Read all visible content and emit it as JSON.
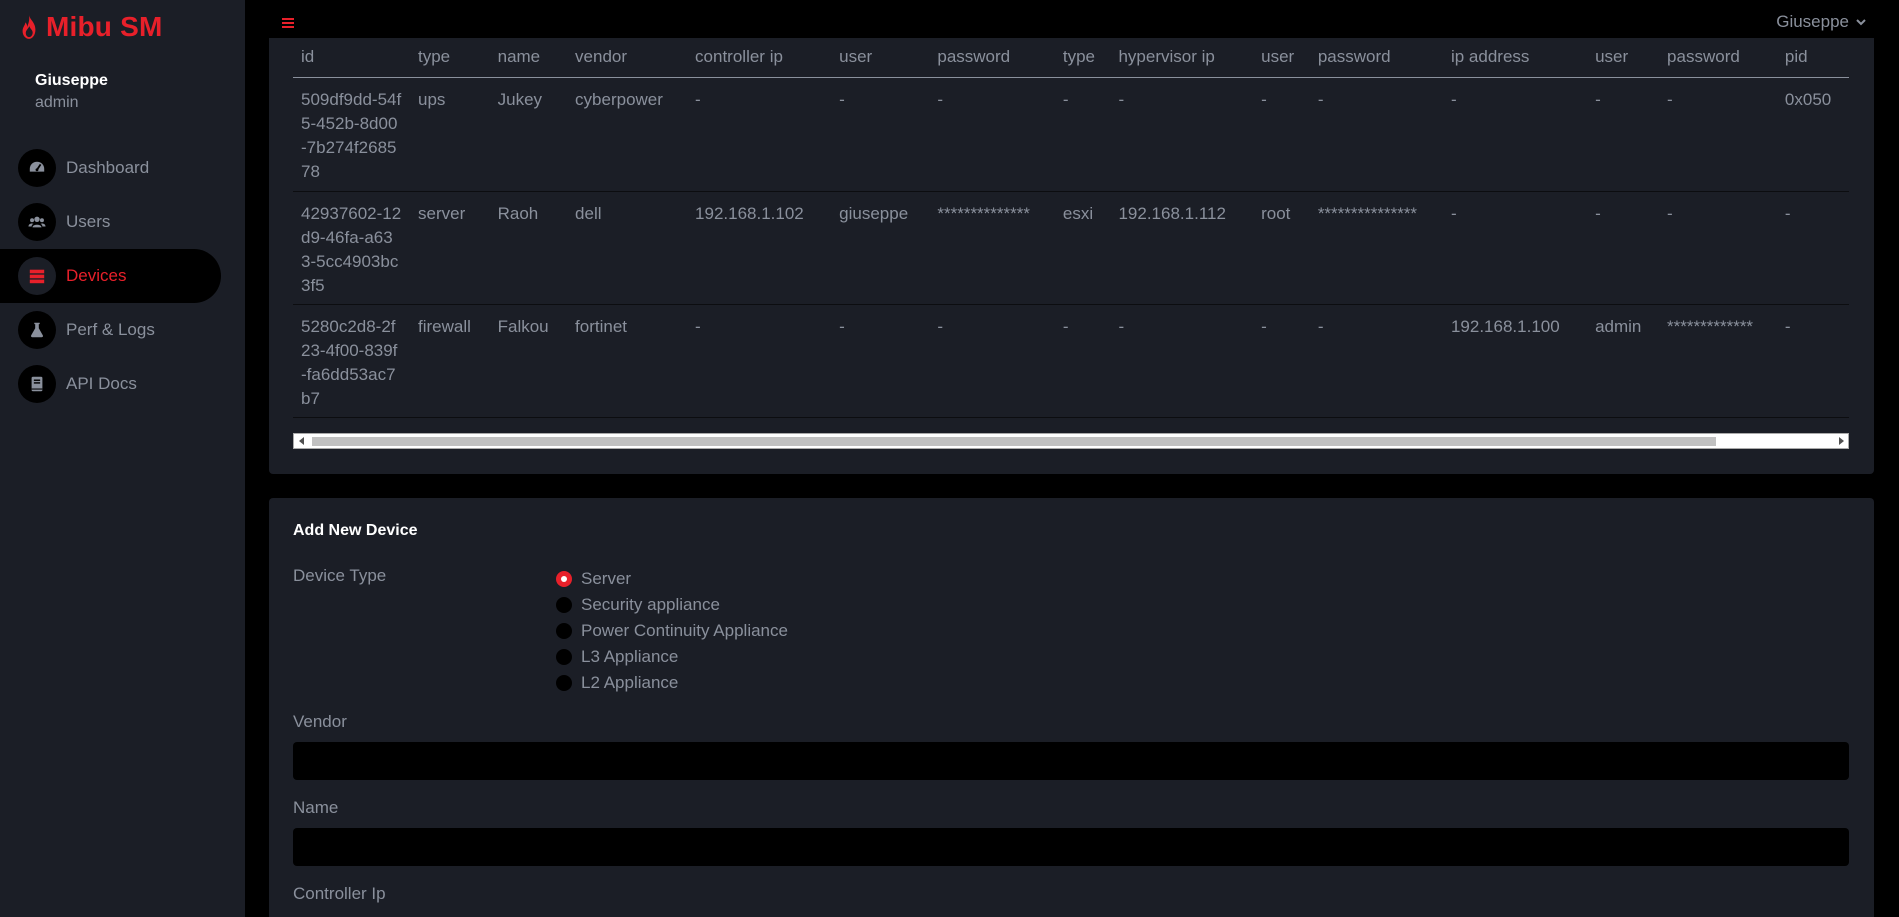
{
  "app": {
    "brand": "Mibu SM",
    "brand_color": "#e8202a"
  },
  "profile": {
    "name": "Giuseppe",
    "role": "admin"
  },
  "topbar": {
    "user_menu_label": "Giuseppe"
  },
  "sidebar": {
    "items": [
      {
        "label": "Dashboard",
        "icon": "dashboard-icon",
        "active": false
      },
      {
        "label": "Users",
        "icon": "users-icon",
        "active": false
      },
      {
        "label": "Devices",
        "icon": "devices-icon",
        "active": true
      },
      {
        "label": "Perf & Logs",
        "icon": "flask-icon",
        "active": false
      },
      {
        "label": "API Docs",
        "icon": "book-icon",
        "active": false
      }
    ]
  },
  "devices_table": {
    "columns": [
      "id",
      "type",
      "name",
      "vendor",
      "controller ip",
      "user",
      "password",
      "type",
      "hypervisor ip",
      "user",
      "password",
      "ip address",
      "user",
      "password",
      "pid"
    ],
    "rows": [
      [
        "509df9dd-54f5-452b-8d00-7b274f268578",
        "ups",
        "Jukey",
        "cyberpower",
        "-",
        "-",
        "-",
        "-",
        "-",
        "-",
        "-",
        "-",
        "-",
        "-",
        "0x050"
      ],
      [
        "42937602-12d9-46fa-a633-5cc4903bc3f5",
        "server",
        "Raoh",
        "dell",
        "192.168.1.102",
        "giuseppe",
        "**************",
        "esxi",
        "192.168.1.112",
        "root",
        "***************",
        "-",
        "-",
        "-",
        "-"
      ],
      [
        "5280c2d8-2f23-4f00-839f-fa6dd53ac7b7",
        "firewall",
        "Falkou",
        "fortinet",
        "-",
        "-",
        "-",
        "-",
        "-",
        "-",
        "-",
        "192.168.1.100",
        "admin",
        "*************",
        "-"
      ]
    ]
  },
  "add_device": {
    "title": "Add New Device",
    "device_type_label": "Device Type",
    "device_types": [
      {
        "label": "Server",
        "checked": true
      },
      {
        "label": "Security appliance",
        "checked": false
      },
      {
        "label": "Power Continuity Appliance",
        "checked": false
      },
      {
        "label": "L3 Appliance",
        "checked": false
      },
      {
        "label": "L2 Appliance",
        "checked": false
      }
    ],
    "vendor_label": "Vendor",
    "vendor_value": "",
    "name_label": "Name",
    "name_value": "",
    "controller_ip_label": "Controller Ip"
  }
}
